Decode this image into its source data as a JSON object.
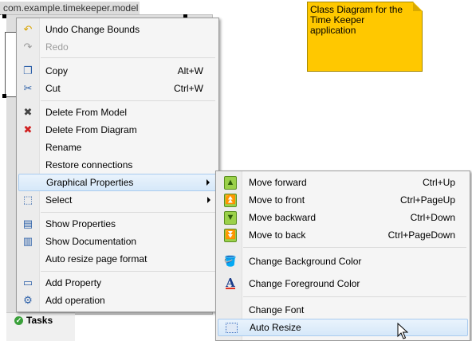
{
  "canvas": {
    "package_label": "com.example.timekeeper.model",
    "note_text": "Class Diagram for the Time Keeper application",
    "tasks_tab_label": "Tasks"
  },
  "context_menu": {
    "items": [
      {
        "label": "Undo Change Bounds",
        "icon": "undo-icon",
        "shortcut": ""
      },
      {
        "label": "Redo",
        "icon": "redo-icon",
        "shortcut": "",
        "disabled": true
      },
      {
        "label": "Copy",
        "icon": "copy-icon",
        "shortcut": "Alt+W"
      },
      {
        "label": "Cut",
        "icon": "cut-icon",
        "shortcut": "Ctrl+W"
      },
      {
        "label": "Delete From Model",
        "icon": "delete-model-icon",
        "shortcut": ""
      },
      {
        "label": "Delete From Diagram",
        "icon": "delete-diagram-icon",
        "shortcut": ""
      },
      {
        "label": "Rename",
        "icon": "",
        "shortcut": ""
      },
      {
        "label": "Restore connections",
        "icon": "",
        "shortcut": ""
      },
      {
        "label": "Graphical Properties",
        "icon": "",
        "shortcut": "",
        "submenu": true,
        "highlighted": true
      },
      {
        "label": "Select",
        "icon": "select-icon",
        "shortcut": "",
        "submenu": true
      },
      {
        "label": "Show Properties",
        "icon": "properties-icon",
        "shortcut": ""
      },
      {
        "label": "Show Documentation",
        "icon": "documentation-icon",
        "shortcut": ""
      },
      {
        "label": "Auto resize page format",
        "icon": "",
        "shortcut": ""
      },
      {
        "label": "Add Property",
        "icon": "property-icon",
        "shortcut": ""
      },
      {
        "label": "Add operation",
        "icon": "operation-icon",
        "shortcut": ""
      }
    ]
  },
  "submenu": {
    "items": [
      {
        "label": "Move forward",
        "icon": "move-forward-icon",
        "shortcut": "Ctrl+Up"
      },
      {
        "label": "Move to front",
        "icon": "move-to-front-icon",
        "shortcut": "Ctrl+PageUp"
      },
      {
        "label": "Move backward",
        "icon": "move-backward-icon",
        "shortcut": "Ctrl+Down"
      },
      {
        "label": "Move to back",
        "icon": "move-to-back-icon",
        "shortcut": "Ctrl+PageDown"
      },
      {
        "label": "Change Background Color",
        "icon": "paint-bucket-icon",
        "shortcut": ""
      },
      {
        "label": "Change Foreground Color",
        "icon": "font-color-icon",
        "shortcut": ""
      },
      {
        "label": "Change Font",
        "icon": "",
        "shortcut": ""
      },
      {
        "label": "Auto Resize",
        "icon": "auto-resize-icon",
        "shortcut": "",
        "highlighted": true
      }
    ]
  },
  "colors": {
    "note_fill": "#ffc800",
    "highlight": "#d6e8f9",
    "menu_bg": "#f5f5f5"
  }
}
